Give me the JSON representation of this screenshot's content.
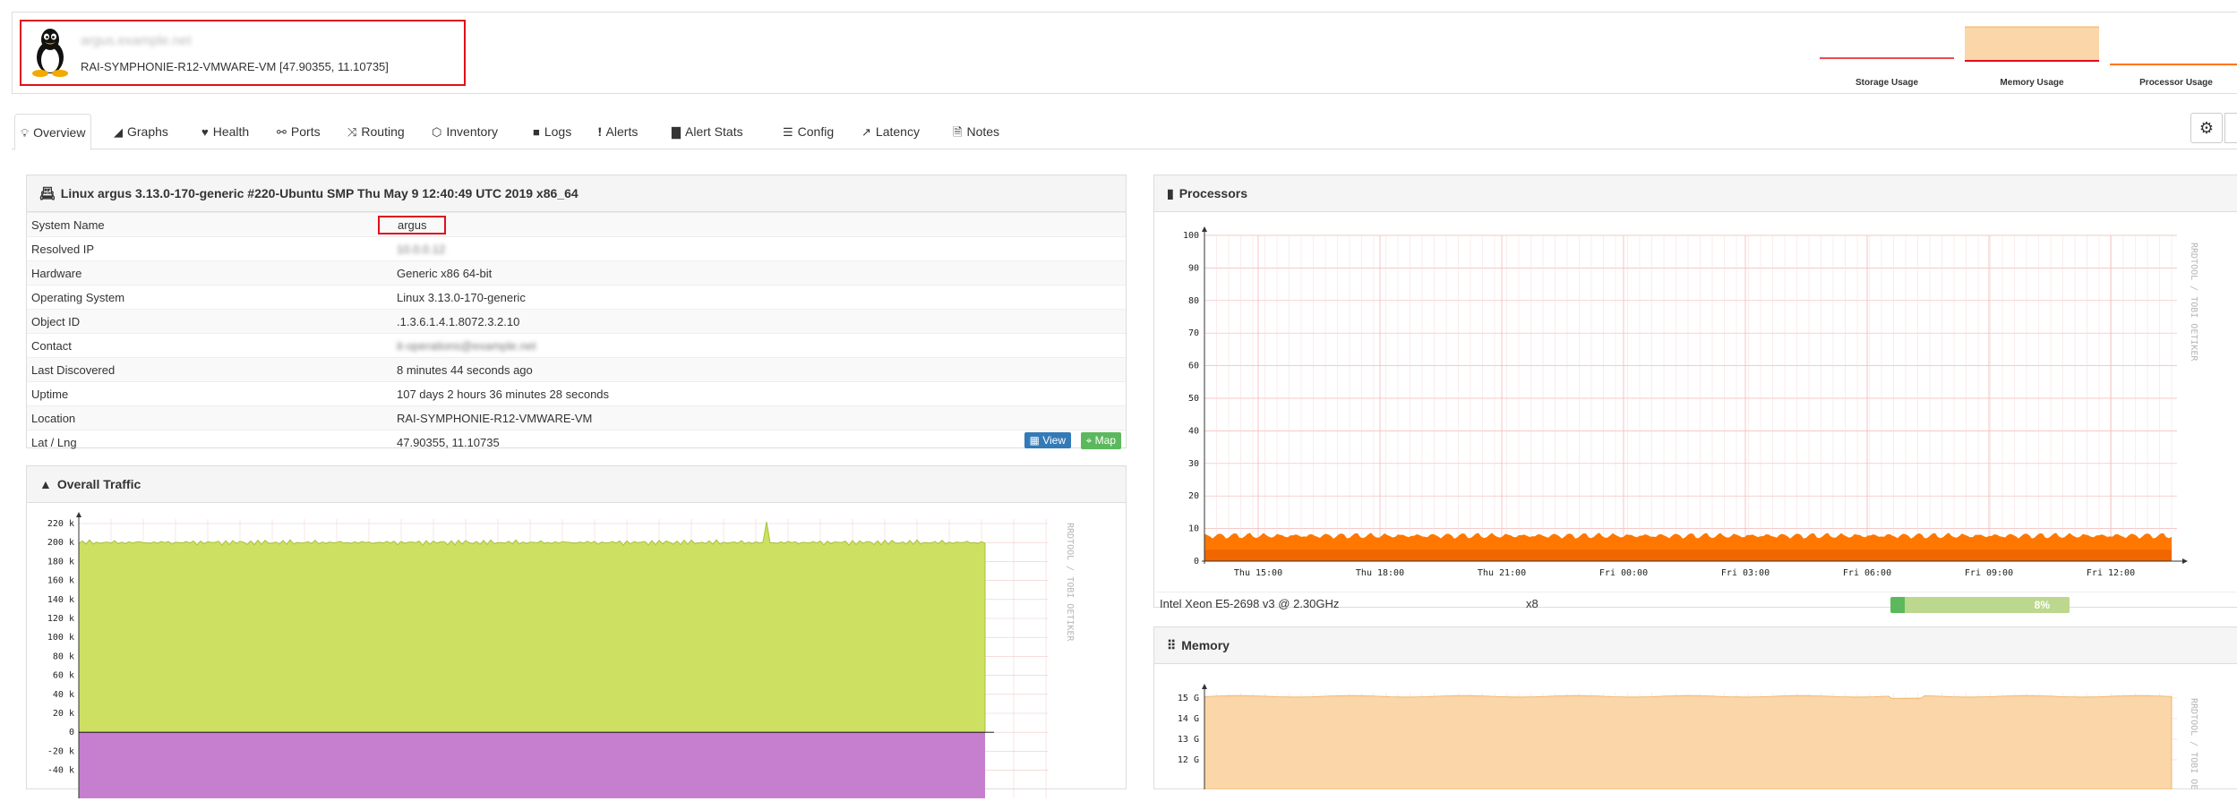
{
  "header": {
    "hostname": "argus.example.net",
    "location": "RAI-SYMPHONIE-R12-VMWARE-VM [47.90355, 11.10735]",
    "sparklines": [
      {
        "label": "Storage Usage"
      },
      {
        "label": "Memory Usage"
      },
      {
        "label": "Processor Usage"
      }
    ]
  },
  "tabs": [
    {
      "label": "Overview",
      "icon": "lightbulb-icon"
    },
    {
      "label": "Graphs",
      "icon": "area-chart-icon"
    },
    {
      "label": "Health",
      "icon": "heartbeat-icon"
    },
    {
      "label": "Ports",
      "icon": "link-icon"
    },
    {
      "label": "Routing",
      "icon": "random-icon"
    },
    {
      "label": "Inventory",
      "icon": "cube-icon"
    },
    {
      "label": "Logs",
      "icon": "book-icon"
    },
    {
      "label": "Alerts",
      "icon": "exclamation-circle-icon"
    },
    {
      "label": "Alert Stats",
      "icon": "bar-chart-icon"
    },
    {
      "label": "Config",
      "icon": "align-justify-icon"
    },
    {
      "label": "Latency",
      "icon": "line-chart-icon"
    },
    {
      "label": "Notes",
      "icon": "file-text-icon"
    }
  ],
  "overview": {
    "title": "Linux argus 3.13.0-170-generic #220-Ubuntu SMP Thu May 9 12:40:49 UTC 2019 x86_64",
    "rows": [
      {
        "key": "System Name",
        "value": "argus"
      },
      {
        "key": "Resolved IP",
        "value": "10.0.0.12"
      },
      {
        "key": "Hardware",
        "value": "Generic x86 64-bit"
      },
      {
        "key": "Operating System",
        "value": "Linux 3.13.0-170-generic"
      },
      {
        "key": "Object ID",
        "value": ".1.3.6.1.4.1.8072.3.2.10"
      },
      {
        "key": "Contact",
        "value": "it-operations@example.net"
      },
      {
        "key": "Last Discovered",
        "value": "8 minutes 44 seconds ago"
      },
      {
        "key": "Uptime",
        "value": "107 days 2 hours 36 minutes 28 seconds"
      },
      {
        "key": "Location",
        "value": "RAI-SYMPHONIE-R12-VMWARE-VM"
      },
      {
        "key": "Lat / Lng",
        "value": "47.90355, 11.10735"
      }
    ],
    "view_label": "View",
    "map_label": "Map"
  },
  "traffic": {
    "title": "Overall Traffic",
    "watermark": "RRDTOOL / TOBI OETIKER",
    "y_ticks": [
      "220 k",
      "200 k",
      "180 k",
      "160 k",
      "140 k",
      "120 k",
      "100 k",
      "80 k",
      "60 k",
      "40 k",
      "20 k",
      "0",
      "-20 k",
      "-40 k"
    ],
    "in_level": 200000,
    "out_level": -45000,
    "colors": {
      "in": "#cde062",
      "in_line": "#a5c43e",
      "out": "#c67fcf",
      "out_line": "#b26abf"
    }
  },
  "processors": {
    "title": "Processors",
    "watermark": "RRDTOOL / TOBI OETIKER",
    "y_ticks": [
      "100",
      "90",
      "80",
      "70",
      "60",
      "50",
      "40",
      "30",
      "20",
      "10",
      "0"
    ],
    "x_ticks": [
      "Thu 15:00",
      "Thu 18:00",
      "Thu 21:00",
      "Fri 00:00",
      "Fri 03:00",
      "Fri 06:00",
      "Fri 09:00",
      "Fri 12:00"
    ],
    "cpu_name": "Intel Xeon E5-2698 v3 @ 2.30GHz",
    "cpu_count": "x8",
    "usage_label": "8%",
    "usage_value": 8,
    "colors": {
      "fill": "#ff7700",
      "fill_dark": "#e35a00",
      "grid": "#f3b7b7"
    }
  },
  "memory": {
    "title": "Memory",
    "watermark": "RRDTOOL / TOBI OETIKER",
    "y_ticks": [
      "15 G",
      "14 G",
      "13 G",
      "12 G"
    ],
    "colors": {
      "fill": "#fad6a8",
      "line": "#f0b060"
    }
  }
}
